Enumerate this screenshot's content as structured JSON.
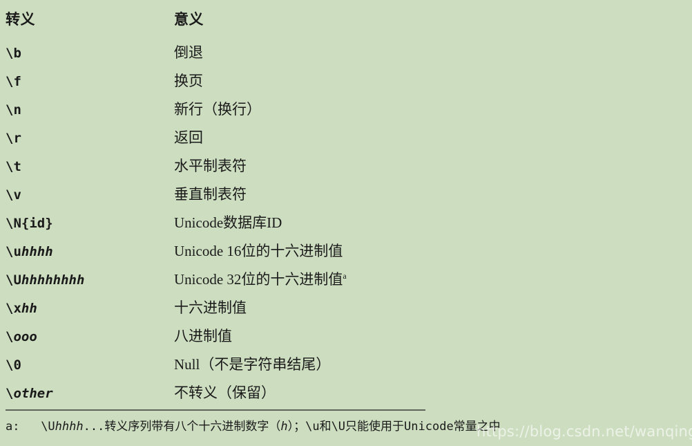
{
  "colors": {
    "background": "#cdddc0",
    "text": "#1a1a1a",
    "rule": "#4a4f45",
    "watermark": "#ffffff"
  },
  "table": {
    "headers": {
      "escape": "转义",
      "meaning": "意义"
    },
    "rows": [
      {
        "escape_plain": "\\b",
        "escape_upright": "\\b",
        "escape_italic": "",
        "meaning": "倒退",
        "footnote_marker": ""
      },
      {
        "escape_plain": "\\f",
        "escape_upright": "\\f",
        "escape_italic": "",
        "meaning": "换页",
        "footnote_marker": ""
      },
      {
        "escape_plain": "\\n",
        "escape_upright": "\\n",
        "escape_italic": "",
        "meaning": "新行（换行）",
        "footnote_marker": ""
      },
      {
        "escape_plain": "\\r",
        "escape_upright": "\\r",
        "escape_italic": "",
        "meaning": "返回",
        "footnote_marker": ""
      },
      {
        "escape_plain": "\\t",
        "escape_upright": "\\t",
        "escape_italic": "",
        "meaning": "水平制表符",
        "footnote_marker": ""
      },
      {
        "escape_plain": "\\v",
        "escape_upright": "\\v",
        "escape_italic": "",
        "meaning": "垂直制表符",
        "footnote_marker": ""
      },
      {
        "escape_plain": "\\N{id}",
        "escape_upright": "\\N{id}",
        "escape_italic": "",
        "meaning": "Unicode数据库ID",
        "footnote_marker": ""
      },
      {
        "escape_plain": "\\uhhhh",
        "escape_upright": "\\u",
        "escape_italic": "hhhh",
        "meaning": "Unicode 16位的十六进制值",
        "footnote_marker": ""
      },
      {
        "escape_plain": "\\Uhhhhhhhh",
        "escape_upright": "\\U",
        "escape_italic": "hhhhhhhh",
        "meaning": "Unicode 32位的十六进制值",
        "footnote_marker": "a"
      },
      {
        "escape_plain": "\\xhh",
        "escape_upright": "\\x",
        "escape_italic": "hh",
        "meaning": "十六进制值",
        "footnote_marker": ""
      },
      {
        "escape_plain": "\\ooo",
        "escape_upright": "\\",
        "escape_italic": "ooo",
        "meaning": "八进制值",
        "footnote_marker": ""
      },
      {
        "escape_plain": "\\0",
        "escape_upright": "\\0",
        "escape_italic": "",
        "meaning": "Null（不是字符串结尾）",
        "footnote_marker": ""
      },
      {
        "escape_plain": "\\other",
        "escape_upright": "\\",
        "escape_italic": "other",
        "meaning": "不转义（保留）",
        "footnote_marker": ""
      }
    ]
  },
  "footnote": {
    "label": "a:",
    "segment_1": "   \\U",
    "segment_italic_1": "hhhh",
    "segment_2": "...转义序列带有八个十六进制数字（",
    "segment_italic_2": "h",
    "segment_3": "）；\\u和\\U只能使用于Unicode常量之中",
    "full_text": "a:   \\Uhhhh...转义序列带有八个十六进制数字（h）；\\u和\\U只能使用于Unicode常量之中"
  },
  "watermark": {
    "text": "https://blog.csdn.net/wanqing_gao"
  }
}
